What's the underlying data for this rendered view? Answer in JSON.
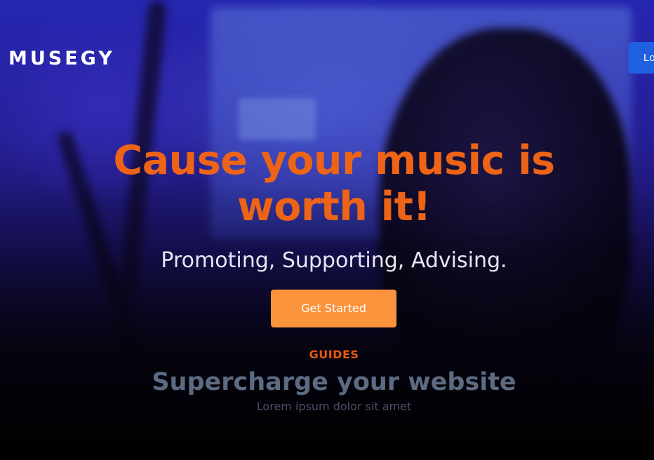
{
  "brand": {
    "logo_text": "MUSEGY"
  },
  "nav": {
    "login_label": "Lo"
  },
  "hero": {
    "headline_line1": "Cause your music is",
    "headline_line2": "worth it!",
    "subheadline": "Promoting, Supporting, Advising.",
    "cta_label": "Get Started"
  },
  "guides": {
    "label": "GUIDES",
    "title": "Supercharge your website",
    "subtitle": "Lorem ipsum dolor sit amet"
  },
  "colors": {
    "headline": "#ee6416",
    "cta_background": "#fb923c",
    "login_button": "#1f5fe0",
    "guides_label": "#ea580c"
  }
}
